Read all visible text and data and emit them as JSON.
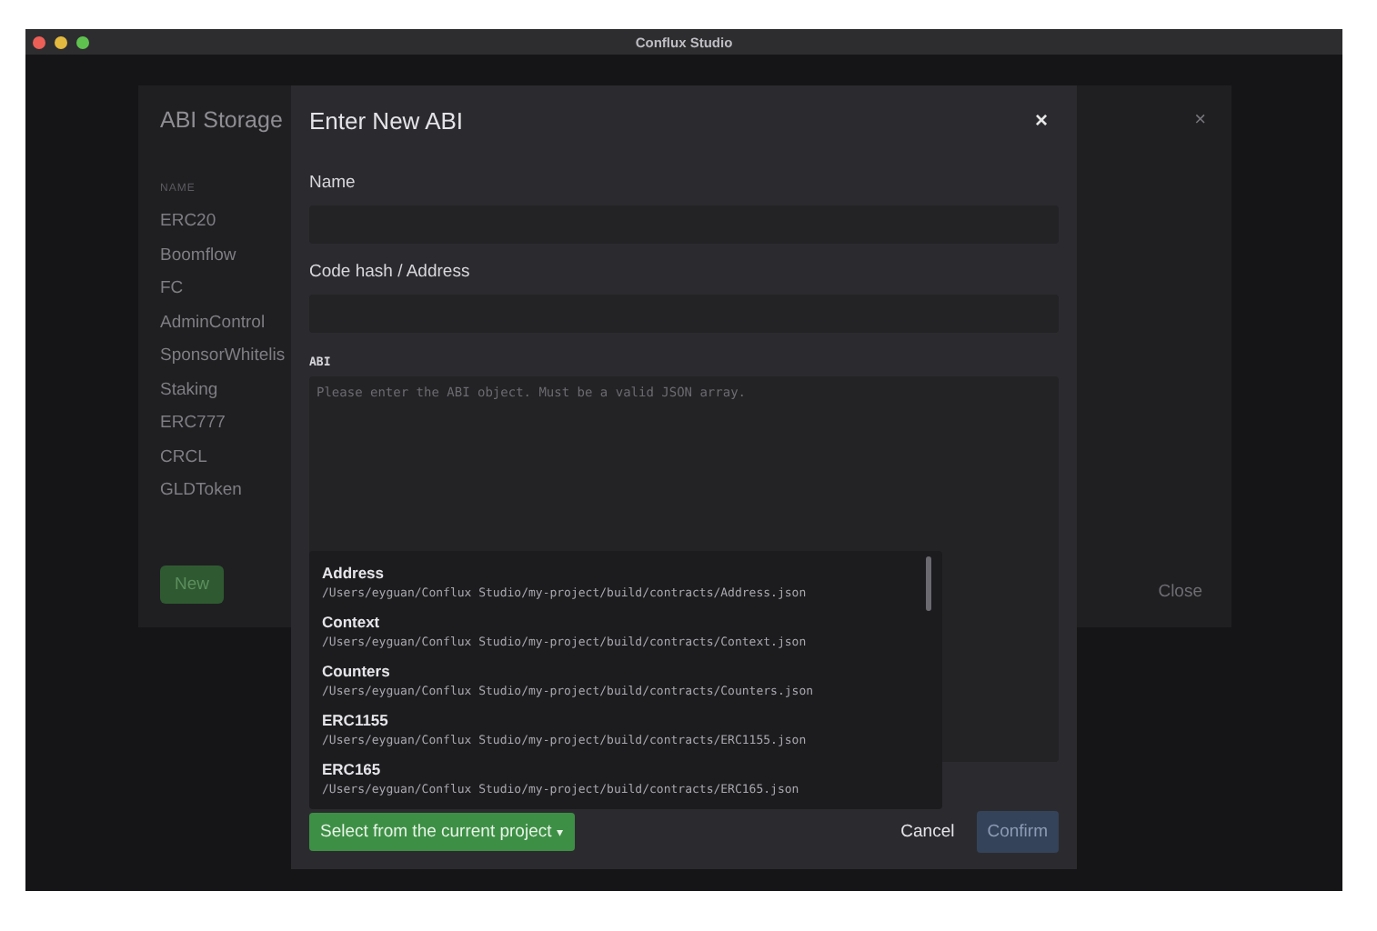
{
  "window": {
    "title": "Conflux Studio"
  },
  "abi_storage": {
    "title": "ABI Storage",
    "column": "NAME",
    "items": [
      "ERC20",
      "Boomflow",
      "FC",
      "AdminControl",
      "SponsorWhitelis",
      "Staking",
      "ERC777",
      "CRCL",
      "GLDToken"
    ],
    "new_button": "New",
    "close_button": "Close",
    "close_icon": "×"
  },
  "enter_abi": {
    "title": "Enter New ABI",
    "close_icon": "×",
    "fields": [
      {
        "label": "Name"
      },
      {
        "label": "Code hash / Address"
      }
    ],
    "abi_label": "ABI",
    "abi_placeholder": "Please enter the ABI object. Must be a valid JSON array.",
    "suggestions": [
      {
        "name": "Address",
        "path": "/Users/eyguan/Conflux Studio/my-project/build/contracts/Address.json"
      },
      {
        "name": "Context",
        "path": "/Users/eyguan/Conflux Studio/my-project/build/contracts/Context.json"
      },
      {
        "name": "Counters",
        "path": "/Users/eyguan/Conflux Studio/my-project/build/contracts/Counters.json"
      },
      {
        "name": "ERC1155",
        "path": "/Users/eyguan/Conflux Studio/my-project/build/contracts/ERC1155.json"
      },
      {
        "name": "ERC165",
        "path": "/Users/eyguan/Conflux Studio/my-project/build/contracts/ERC165.json"
      }
    ],
    "select_button": "Select from the current project",
    "caret": "▾",
    "cancel_button": "Cancel",
    "confirm_button": {
      "label": "Confirm",
      "disabled": true
    }
  }
}
